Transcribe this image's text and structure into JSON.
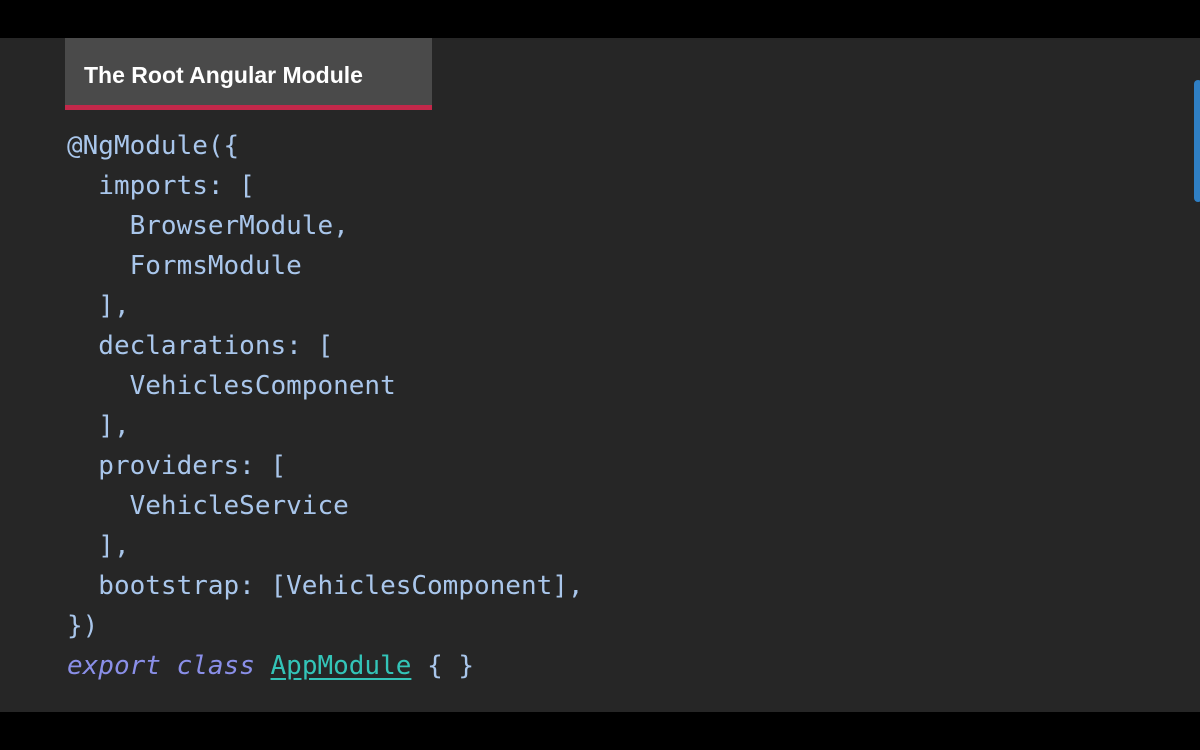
{
  "slide": {
    "title": "The Root Angular Module"
  },
  "code": {
    "lines": [
      "@NgModule({",
      "  imports: [",
      "    BrowserModule,",
      "    FormsModule",
      "  ],",
      "  declarations: [",
      "    VehiclesComponent",
      "  ],",
      "  providers: [",
      "    VehicleService",
      "  ],",
      "  bootstrap: [VehiclesComponent],",
      "})"
    ],
    "export_keyword": "export",
    "class_keyword": "class",
    "class_name": "AppModule",
    "class_body": "{ }"
  },
  "colors": {
    "background": "#262626",
    "title_bar": "#4a4a4a",
    "accent": "#c3284a",
    "code_text": "#a9c6eb",
    "keyword": "#8a8fe8",
    "class_name": "#33c4b8",
    "scroll_handle": "#2f7fc4"
  }
}
